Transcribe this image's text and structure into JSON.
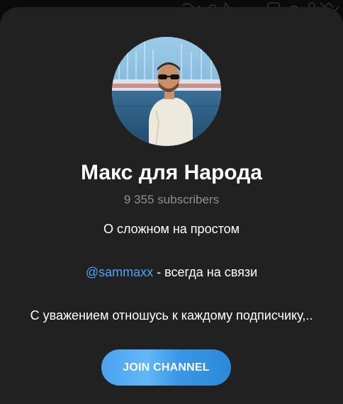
{
  "channel": {
    "title": "Макс для Народа",
    "subscribers": "9 355 subscribers",
    "description": {
      "line1": "О сложном на простом",
      "mention": "@sammaxx",
      "line2_rest": " - всегда на связи",
      "line3": "С уважением отношусь к каждому подписчику,.."
    },
    "join_label": "JOIN CHANNEL"
  },
  "colors": {
    "background": "#212121",
    "accent": "#4ea4f5",
    "muted_text": "#8f8f8f"
  }
}
